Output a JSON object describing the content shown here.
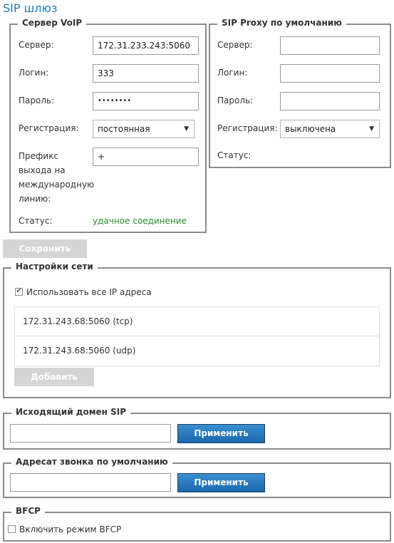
{
  "page": {
    "title": "SIP шлюз"
  },
  "voip_server": {
    "legend": "Сервер VoIP",
    "server_label": "Сервер:",
    "server_value": "172.31.233.243:5060",
    "login_label": "Логин:",
    "login_value": "333",
    "password_label": "Пароль:",
    "password_value": "••••••••",
    "registration_label": "Регистрация:",
    "registration_value": "постоянная",
    "prefix_label": "Префикс выхода на международную линию:",
    "prefix_value": "+",
    "status_label": "Статус:",
    "status_value": "удачное соединение"
  },
  "sip_proxy": {
    "legend": "SIP Proxy по умолчанию",
    "server_label": "Сервер:",
    "login_label": "Логин:",
    "password_label": "Пароль:",
    "registration_label": "Регистрация:",
    "registration_value": "выключена",
    "status_label": "Статус:"
  },
  "save_button": "Сохранить",
  "network": {
    "legend": "Настройки сети",
    "use_all_ip_label": "Использовать все IP адреса",
    "use_all_ip_checked": true,
    "addresses": [
      "172.31.243.68:5060 (tcp)",
      "172.31.243.68:5060 (udp)"
    ],
    "add_button": "Добавить"
  },
  "outgoing_domain": {
    "legend": "Исходящий домен SIP",
    "apply_button": "Применить"
  },
  "default_callee": {
    "legend": "Адресат звонка по умолчанию",
    "apply_button": "Применить"
  },
  "bfcp": {
    "legend": "BFCP",
    "enable_label": "Включить режим BFCP",
    "enabled": false
  }
}
